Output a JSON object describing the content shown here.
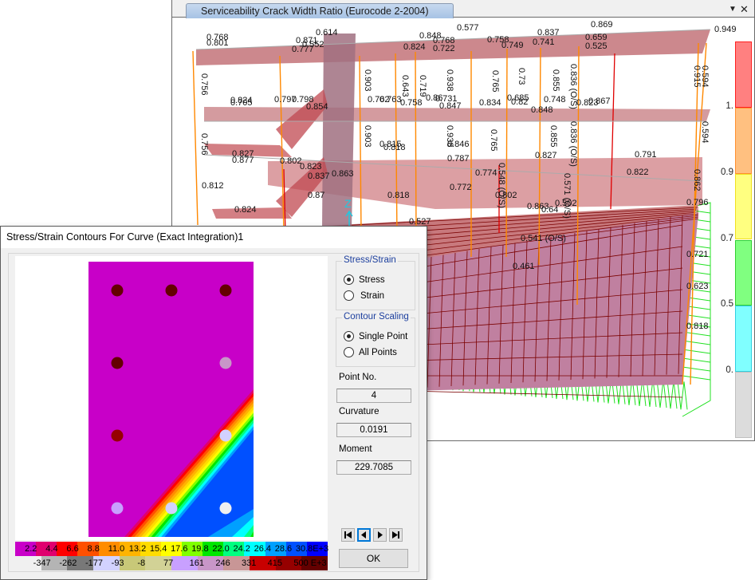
{
  "view3d": {
    "tab_title": "Serviceability Crack Width Ratio  (Eurocode 2-2004)",
    "dropdown_icon": "triangle-down-icon",
    "close_icon": "close-icon",
    "axis_label": "Z",
    "legend": {
      "bands": [
        {
          "color": "#ff8080",
          "border": "#ff2020"
        },
        {
          "color": "#ffc080",
          "border": "#ff9030"
        },
        {
          "color": "#ffff80",
          "border": "#f0e020"
        },
        {
          "color": "#80ff80",
          "border": "#30d030"
        },
        {
          "color": "#80ffff",
          "border": "#30d0e0"
        },
        {
          "color": "#dcdcdc",
          "border": "#c0c0c0"
        }
      ],
      "labels": [
        "1.",
        "0.9",
        "0.7",
        "0.5",
        "0."
      ]
    },
    "annotations": {
      "roof": [
        "0.768",
        "0.801",
        "0.871",
        "0.552",
        "0.614",
        "0.777",
        "0.824",
        "0.848",
        "0.577",
        "0.768",
        "0.722",
        "0.758",
        "0.837",
        "0.749",
        "0.741",
        "0.869",
        "0.659",
        "0.525",
        "0.949"
      ],
      "upper_floor": [
        "0.824",
        "0.705",
        "0.797",
        "0.798",
        "0.854",
        "0.762",
        "0.763",
        "0.758",
        "0.86",
        "0.731",
        "0.847",
        "0.834",
        "0.685",
        "0.82",
        "0.748",
        "0.848",
        "0.823",
        "0.867"
      ],
      "columns_upper": [
        "0.756",
        "0.903",
        "0.643",
        "0.719",
        "0.938",
        "0.765",
        "0.73",
        "0.855",
        "0.836 (O/S)",
        "0.915",
        "0.594"
      ],
      "mid_floor": [
        "0.827",
        "0.877",
        "0.802",
        "0.823",
        "0.837",
        "0.863",
        "0.815",
        "0.818",
        "0.846",
        "0.787",
        "0.774",
        "0.827",
        "0.791",
        "0.822",
        "0.772",
        "0.802",
        "0.863",
        "0.64",
        "0.818"
      ],
      "columns_mid": [
        "0.756",
        "0.903",
        "0.938",
        "0.765",
        "0.855",
        "0.836 (O/S)",
        "0.548 (O/S)",
        "0.571 (O/S)",
        "0.594",
        "0.862"
      ],
      "lower": [
        "0.812",
        "0.824",
        "0.87",
        "0.502",
        "0.796",
        "0.527",
        "0.541 (O/S)",
        "0.461",
        "0.721",
        "0.623",
        "0.818"
      ]
    }
  },
  "dialog": {
    "title": "Stress/Strain Contours For Curve (Exact Integration)1",
    "stress_strain_group": {
      "title": "Stress/Strain",
      "options": [
        {
          "label": "Stress",
          "selected": true
        },
        {
          "label": "Strain",
          "selected": false
        }
      ]
    },
    "contour_scaling_group": {
      "title": "Contour Scaling",
      "options": [
        {
          "label": "Single Point",
          "selected": true
        },
        {
          "label": "All Points",
          "selected": false
        }
      ]
    },
    "point_no": {
      "label": "Point No.",
      "value": "4"
    },
    "curvature": {
      "label": "Curvature",
      "value": "0.0191"
    },
    "moment": {
      "label": "Moment",
      "value": "229.7085"
    },
    "nav_buttons": [
      {
        "name": "first-point-button",
        "icon": "skip-first-icon"
      },
      {
        "name": "previous-point-button",
        "icon": "previous-icon"
      },
      {
        "name": "next-point-button",
        "icon": "next-icon"
      },
      {
        "name": "last-point-button",
        "icon": "skip-last-icon"
      }
    ],
    "ok_label": "OK",
    "concrete_scale": {
      "labels": [
        "2.2",
        "4.4",
        "6.6",
        "8.8",
        "11.0",
        "13.2",
        "15.4",
        "17.6",
        "19.8",
        "22.0",
        "24.2",
        "26.4",
        "28.6",
        "30.8E+3"
      ],
      "colors": [
        "#c800c8",
        "#e0006e",
        "#ff0000",
        "#ff5000",
        "#ff8c00",
        "#ffb400",
        "#ffdc00",
        "#ffff00",
        "#80ff00",
        "#00e600",
        "#00ff80",
        "#00ffff",
        "#00a0ff",
        "#0050ff",
        "#0000ff"
      ]
    },
    "steel_scale": {
      "labels": [
        "-347",
        "-262",
        "-177",
        "-93",
        "-8",
        "77",
        "161",
        "246",
        "331",
        "415",
        "500 E+3"
      ],
      "colors": [
        "#f0f0f0",
        "#b4b4b4",
        "#787878",
        "#d2d2ff",
        "#c8c878",
        "#d2d296",
        "#c8a0ff",
        "#c896c8",
        "#c89696",
        "#c80000",
        "#960000",
        "#640000"
      ]
    },
    "rebars": [
      {
        "row": 0,
        "col": 0,
        "color": "#640000"
      },
      {
        "row": 0,
        "col": 1,
        "color": "#640000"
      },
      {
        "row": 0,
        "col": 2,
        "color": "#640000"
      },
      {
        "row": 1,
        "col": 0,
        "color": "#640000"
      },
      {
        "row": 1,
        "col": 2,
        "color": "#c896c8"
      },
      {
        "row": 2,
        "col": 0,
        "color": "#960000"
      },
      {
        "row": 2,
        "col": 2,
        "color": "#d2d2ff"
      },
      {
        "row": 3,
        "col": 0,
        "color": "#c8a0ff"
      },
      {
        "row": 3,
        "col": 1,
        "color": "#d2d2ff"
      },
      {
        "row": 3,
        "col": 2,
        "color": "#f0f0f0"
      }
    ],
    "section_fill_color": "#c800c8"
  }
}
